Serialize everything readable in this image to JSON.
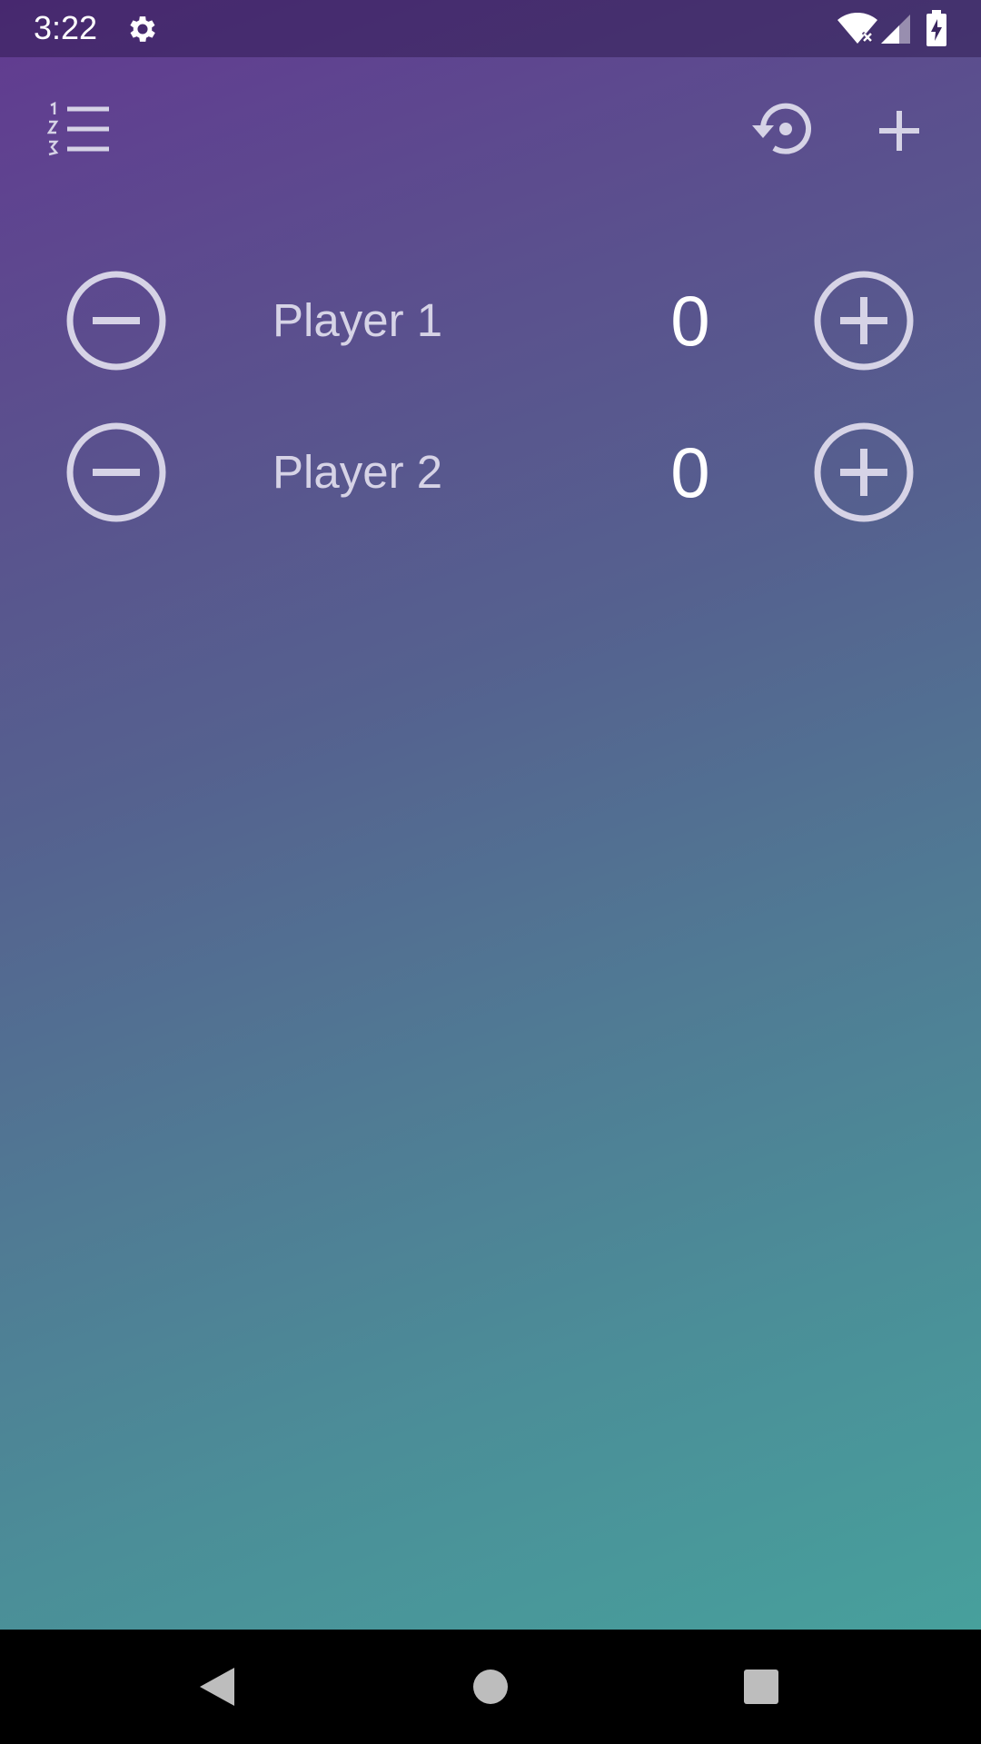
{
  "status_bar": {
    "time": "3:22",
    "icons": [
      "settings-gear-icon",
      "wifi-no-internet-icon",
      "cell-signal-icon",
      "battery-charging-icon"
    ]
  },
  "toolbar": {
    "left_icon": "numbered-list-icon",
    "right_icons": [
      "reset-scores-icon",
      "add-player-icon"
    ]
  },
  "players": [
    {
      "name": "Player 1",
      "score": "0"
    },
    {
      "name": "Player 2",
      "score": "0"
    }
  ],
  "navigation": {
    "icons": [
      "back-icon",
      "home-icon",
      "recents-icon"
    ]
  },
  "colors": {
    "gradient_start": "#623a91",
    "gradient_end": "#47a09c",
    "button_outline": "#d6d3e6",
    "score_text": "#ffffff",
    "nav_bar": "#000000"
  }
}
